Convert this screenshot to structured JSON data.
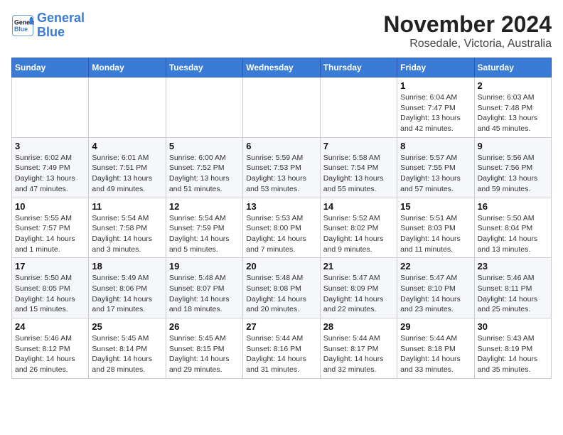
{
  "header": {
    "logo_line1": "General",
    "logo_line2": "Blue",
    "month": "November 2024",
    "location": "Rosedale, Victoria, Australia"
  },
  "weekdays": [
    "Sunday",
    "Monday",
    "Tuesday",
    "Wednesday",
    "Thursday",
    "Friday",
    "Saturday"
  ],
  "weeks": [
    [
      {
        "day": "",
        "info": ""
      },
      {
        "day": "",
        "info": ""
      },
      {
        "day": "",
        "info": ""
      },
      {
        "day": "",
        "info": ""
      },
      {
        "day": "",
        "info": ""
      },
      {
        "day": "1",
        "info": "Sunrise: 6:04 AM\nSunset: 7:47 PM\nDaylight: 13 hours\nand 42 minutes."
      },
      {
        "day": "2",
        "info": "Sunrise: 6:03 AM\nSunset: 7:48 PM\nDaylight: 13 hours\nand 45 minutes."
      }
    ],
    [
      {
        "day": "3",
        "info": "Sunrise: 6:02 AM\nSunset: 7:49 PM\nDaylight: 13 hours\nand 47 minutes."
      },
      {
        "day": "4",
        "info": "Sunrise: 6:01 AM\nSunset: 7:51 PM\nDaylight: 13 hours\nand 49 minutes."
      },
      {
        "day": "5",
        "info": "Sunrise: 6:00 AM\nSunset: 7:52 PM\nDaylight: 13 hours\nand 51 minutes."
      },
      {
        "day": "6",
        "info": "Sunrise: 5:59 AM\nSunset: 7:53 PM\nDaylight: 13 hours\nand 53 minutes."
      },
      {
        "day": "7",
        "info": "Sunrise: 5:58 AM\nSunset: 7:54 PM\nDaylight: 13 hours\nand 55 minutes."
      },
      {
        "day": "8",
        "info": "Sunrise: 5:57 AM\nSunset: 7:55 PM\nDaylight: 13 hours\nand 57 minutes."
      },
      {
        "day": "9",
        "info": "Sunrise: 5:56 AM\nSunset: 7:56 PM\nDaylight: 13 hours\nand 59 minutes."
      }
    ],
    [
      {
        "day": "10",
        "info": "Sunrise: 5:55 AM\nSunset: 7:57 PM\nDaylight: 14 hours\nand 1 minute."
      },
      {
        "day": "11",
        "info": "Sunrise: 5:54 AM\nSunset: 7:58 PM\nDaylight: 14 hours\nand 3 minutes."
      },
      {
        "day": "12",
        "info": "Sunrise: 5:54 AM\nSunset: 7:59 PM\nDaylight: 14 hours\nand 5 minutes."
      },
      {
        "day": "13",
        "info": "Sunrise: 5:53 AM\nSunset: 8:00 PM\nDaylight: 14 hours\nand 7 minutes."
      },
      {
        "day": "14",
        "info": "Sunrise: 5:52 AM\nSunset: 8:02 PM\nDaylight: 14 hours\nand 9 minutes."
      },
      {
        "day": "15",
        "info": "Sunrise: 5:51 AM\nSunset: 8:03 PM\nDaylight: 14 hours\nand 11 minutes."
      },
      {
        "day": "16",
        "info": "Sunrise: 5:50 AM\nSunset: 8:04 PM\nDaylight: 14 hours\nand 13 minutes."
      }
    ],
    [
      {
        "day": "17",
        "info": "Sunrise: 5:50 AM\nSunset: 8:05 PM\nDaylight: 14 hours\nand 15 minutes."
      },
      {
        "day": "18",
        "info": "Sunrise: 5:49 AM\nSunset: 8:06 PM\nDaylight: 14 hours\nand 17 minutes."
      },
      {
        "day": "19",
        "info": "Sunrise: 5:48 AM\nSunset: 8:07 PM\nDaylight: 14 hours\nand 18 minutes."
      },
      {
        "day": "20",
        "info": "Sunrise: 5:48 AM\nSunset: 8:08 PM\nDaylight: 14 hours\nand 20 minutes."
      },
      {
        "day": "21",
        "info": "Sunrise: 5:47 AM\nSunset: 8:09 PM\nDaylight: 14 hours\nand 22 minutes."
      },
      {
        "day": "22",
        "info": "Sunrise: 5:47 AM\nSunset: 8:10 PM\nDaylight: 14 hours\nand 23 minutes."
      },
      {
        "day": "23",
        "info": "Sunrise: 5:46 AM\nSunset: 8:11 PM\nDaylight: 14 hours\nand 25 minutes."
      }
    ],
    [
      {
        "day": "24",
        "info": "Sunrise: 5:46 AM\nSunset: 8:12 PM\nDaylight: 14 hours\nand 26 minutes."
      },
      {
        "day": "25",
        "info": "Sunrise: 5:45 AM\nSunset: 8:14 PM\nDaylight: 14 hours\nand 28 minutes."
      },
      {
        "day": "26",
        "info": "Sunrise: 5:45 AM\nSunset: 8:15 PM\nDaylight: 14 hours\nand 29 minutes."
      },
      {
        "day": "27",
        "info": "Sunrise: 5:44 AM\nSunset: 8:16 PM\nDaylight: 14 hours\nand 31 minutes."
      },
      {
        "day": "28",
        "info": "Sunrise: 5:44 AM\nSunset: 8:17 PM\nDaylight: 14 hours\nand 32 minutes."
      },
      {
        "day": "29",
        "info": "Sunrise: 5:44 AM\nSunset: 8:18 PM\nDaylight: 14 hours\nand 33 minutes."
      },
      {
        "day": "30",
        "info": "Sunrise: 5:43 AM\nSunset: 8:19 PM\nDaylight: 14 hours\nand 35 minutes."
      }
    ]
  ]
}
